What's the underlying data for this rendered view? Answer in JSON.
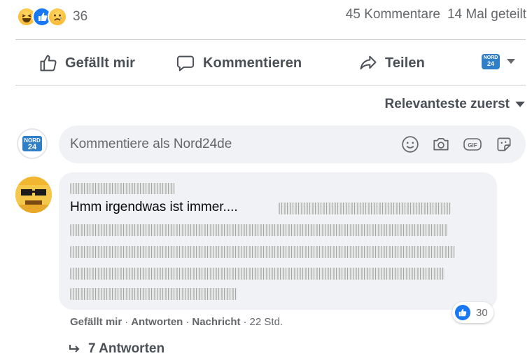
{
  "reactions": {
    "icons": [
      "laugh-reaction-icon",
      "like-reaction-icon",
      "sad-reaction-icon"
    ],
    "count": "36"
  },
  "stats": {
    "comments": "45 Kommentare",
    "shares": "14 Mal geteilt"
  },
  "actions": {
    "like": "Gefällt mir",
    "comment": "Kommentieren",
    "share": "Teilen"
  },
  "page_logo": {
    "line1": "NORD",
    "line2": "24"
  },
  "sort": {
    "label": "Relevanteste zuerst"
  },
  "composer": {
    "placeholder": "Kommentiere als Nord24de"
  },
  "comment": {
    "text": "Hmm irgendwas ist immer....",
    "reaction_count": "30",
    "like": "Gefällt mir",
    "reply": "Antworten",
    "message": "Nachricht",
    "time": "22 Std.",
    "replies": "7 Antworten"
  },
  "colors": {
    "brand_blue": "#1877f2",
    "bubble": "#f0f2f5",
    "muted": "#65676b"
  }
}
